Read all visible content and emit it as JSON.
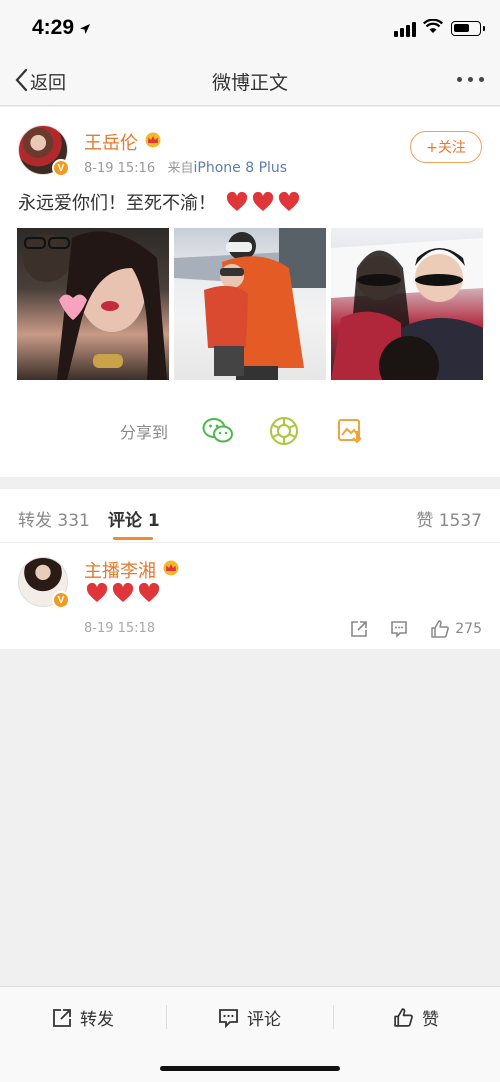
{
  "status_bar": {
    "time": "4:29"
  },
  "nav": {
    "back_label": "返回",
    "title": "微博正文"
  },
  "post": {
    "author": "王岳伦",
    "time": "8-19 15:16",
    "source_prefix": "来自",
    "source": "iPhone 8 Plus",
    "follow_label": "+关注",
    "text": "永远爱你们！至死不渝！",
    "share_label": "分享到"
  },
  "tabs": {
    "repost_label": "转发",
    "repost_count": "331",
    "comment_label": "评论",
    "comment_count": "1",
    "like_label": "赞",
    "like_count": "1537"
  },
  "comment": {
    "author": "主播李湘",
    "time": "8-19 15:18",
    "likes": "275"
  },
  "bottom_bar": {
    "repost": "转发",
    "comment": "评论",
    "like": "赞"
  },
  "colors": {
    "accent": "#e8782e",
    "heart": "#e0363a"
  }
}
